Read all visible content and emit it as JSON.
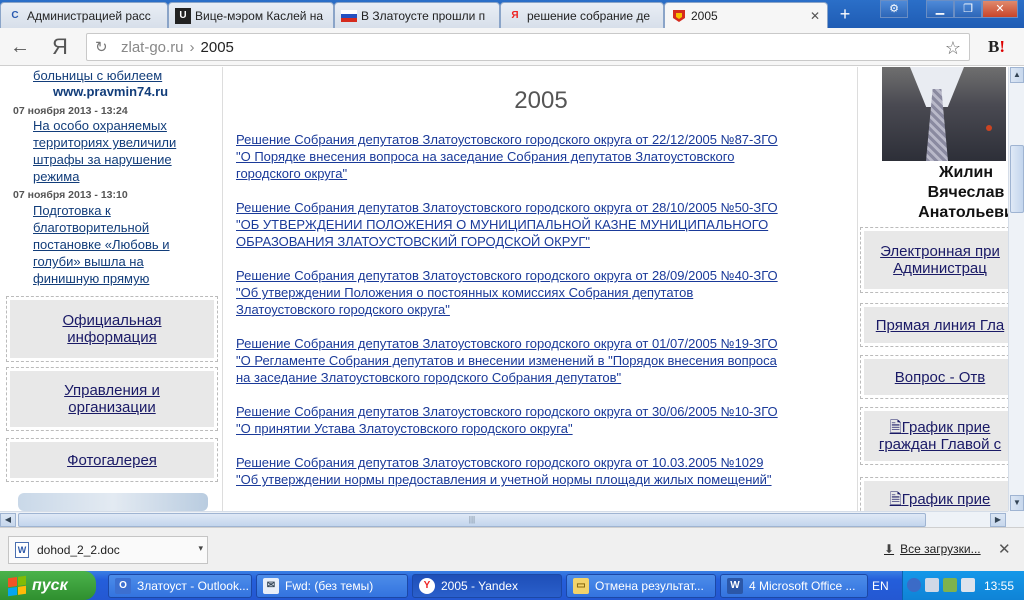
{
  "browser": {
    "tabs": [
      {
        "label": "Администрацией расс",
        "favicon": "C",
        "active": false
      },
      {
        "label": "Вице-мэром Каслей на",
        "favicon": "U",
        "active": false
      },
      {
        "label": "В Златоусте прошли п",
        "favicon": "flag",
        "active": false
      },
      {
        "label": "решение собрание де",
        "favicon": "Я",
        "active": false
      },
      {
        "label": "2005",
        "favicon": "emblem",
        "active": true
      }
    ],
    "new_tab": "+",
    "yandex_button": "Я",
    "address": {
      "domain": "zlat-go.ru",
      "separator": "›",
      "path": "2005"
    },
    "extension": {
      "label": "В",
      "accent": "!"
    }
  },
  "sidebar_left": {
    "news": [
      {
        "title_lines": [
          "больницы с юбилеем"
        ],
        "source": "www.pravmin74.ru"
      },
      {
        "date": "07 ноября 2013 - 13:24",
        "title_lines": [
          "На особо охраняемых",
          "территориях увеличили",
          "штрафы за нарушение",
          "режима"
        ]
      },
      {
        "date": "07 ноября 2013 - 13:10",
        "title_lines": [
          "Подготовка к",
          "благотворительной",
          "постановке «Любовь и",
          "голуби» вышла на",
          "финишную прямую"
        ]
      }
    ],
    "menu": [
      {
        "lines": [
          "Официальная",
          "информация"
        ]
      },
      {
        "lines": [
          "Управления и",
          "организации"
        ]
      },
      {
        "lines": [
          "Фотогалерея"
        ]
      }
    ]
  },
  "main": {
    "heading": "2005",
    "documents": [
      {
        "lines": [
          "Решение Собрания депутатов Златоустовского городского округа от 22/12/2005 №87-ЗГО",
          "\"О Порядке внесения вопроса на заседание Собрания депутатов Златоустовского",
          "городского округа\""
        ]
      },
      {
        "lines": [
          "Решение Собрания депутатов Златоустовского городского округа от 28/10/2005 №50-ЗГО",
          "\"ОБ УТВЕРЖДЕНИИ ПОЛОЖЕНИЯ О МУНИЦИПАЛЬНОЙ КАЗНЕ МУНИЦИПАЛЬНОГО",
          "ОБРАЗОВАНИЯ ЗЛАТОУСТОВСКИЙ ГОРОДСКОЙ ОКРУГ\""
        ]
      },
      {
        "lines": [
          "Решение Собрания депутатов Златоустовского городского округа от 28/09/2005 №40-ЗГО",
          "\"Об утверждении Положения о постоянных комиссиях Собрания депутатов",
          "Златоустовского городского округа\""
        ]
      },
      {
        "lines": [
          "Решение Собрания депутатов Златоустовского городского округа от 01/07/2005 №19-ЗГО",
          "\"О Регламенте Собрания депутатов и внесении изменений в \"Порядок внесения вопроса",
          "на заседание Златоустовского городского Собрания депутатов\""
        ]
      },
      {
        "lines": [
          "Решение Собрания депутатов Златоустовского городского округа от 30/06/2005 №10-ЗГО",
          "\"О принятии Устава Златоустовского городского округа\""
        ]
      },
      {
        "lines": [
          "Решение Собрания депутатов Златоустовского городского округа от 10.03.2005 №1029",
          "\"Об утверждении нормы предоставления и учетной нормы площади жилых помещений\""
        ]
      }
    ]
  },
  "sidebar_right": {
    "mayor_name_lines": [
      "Жилин",
      "Вячеслав",
      "Анатольеви"
    ],
    "links": [
      {
        "lines": [
          "Электронная при",
          "Администрац"
        ]
      },
      {
        "lines": [
          "Прямая линия Гла"
        ]
      },
      {
        "lines": [
          "Вопрос - Отв"
        ]
      },
      {
        "lines": [
          "График прие",
          "граждан Главой с"
        ],
        "icon": "document-icon"
      },
      {
        "lines": [
          "График прие"
        ],
        "icon": "document-icon"
      }
    ]
  },
  "downloads": {
    "file": "dohod_2_2.doc",
    "all_label": "Все загрузки...",
    "close": "✕"
  },
  "taskbar": {
    "start": "пуск",
    "tasks": [
      {
        "label": "Златоуст - Outlook...",
        "icon": "outlook"
      },
      {
        "label": "Fwd: (без темы)",
        "icon": "mail"
      },
      {
        "label": "2005 - Yandex",
        "icon": "yandex",
        "active": true
      },
      {
        "label": "Отмена результат...",
        "icon": "folder"
      },
      {
        "label": "4 Microsoft Office ...",
        "icon": "word"
      }
    ],
    "language": "EN",
    "clock": "13:55"
  },
  "colors": {
    "link": "#1a3a99",
    "taskbar": "#245edb",
    "start": "#3a9a3a"
  }
}
